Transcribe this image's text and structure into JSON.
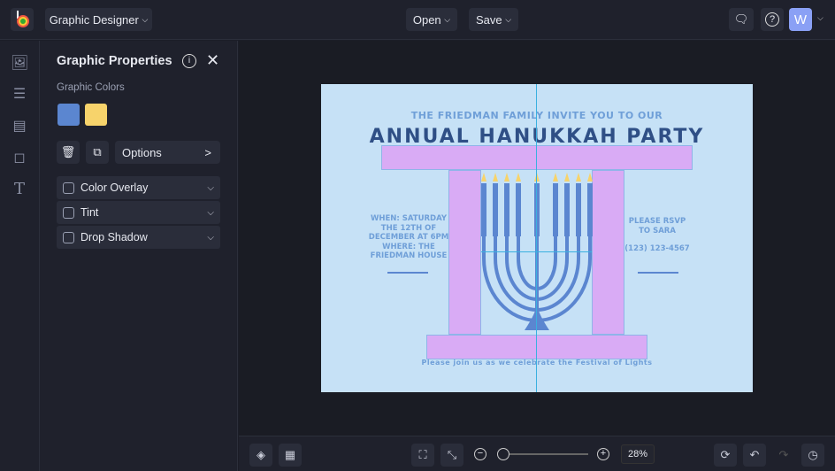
{
  "header": {
    "app_menu": "Graphic Designer",
    "open": "Open",
    "save": "Save",
    "avatar": "W"
  },
  "panel": {
    "title": "Graphic Properties",
    "colors_label": "Graphic Colors",
    "swatches": [
      "#5b86d0",
      "#f7d36b"
    ],
    "options": "Options",
    "options_arrow": ">",
    "effects": [
      {
        "label": "Color Overlay"
      },
      {
        "label": "Tint"
      },
      {
        "label": "Drop Shadow"
      }
    ]
  },
  "canvas": {
    "line1": "THE FRIEDMAN FAMILY INVITE YOU TO OUR",
    "title": "ANNUAL HANUKKAH PARTY",
    "when": "WHEN: SATURDAY THE 12TH OF DECEMBER AT 6PM",
    "where": "WHERE: THE FRIEDMAN HOUSE",
    "rsvp": "PLEASE RSVP TO SARA",
    "phone": "(123) 123-4567",
    "footer": "Please join us as we celebrate the Festival of Lights"
  },
  "zoom": {
    "label": "28%",
    "value": 28
  },
  "colors": {
    "accent": "#8aa0f5",
    "canvas_bg": "#c6e1f6",
    "purple": "#d9abf5",
    "menorah": "#5b86d0",
    "flame": "#f7d36b"
  }
}
